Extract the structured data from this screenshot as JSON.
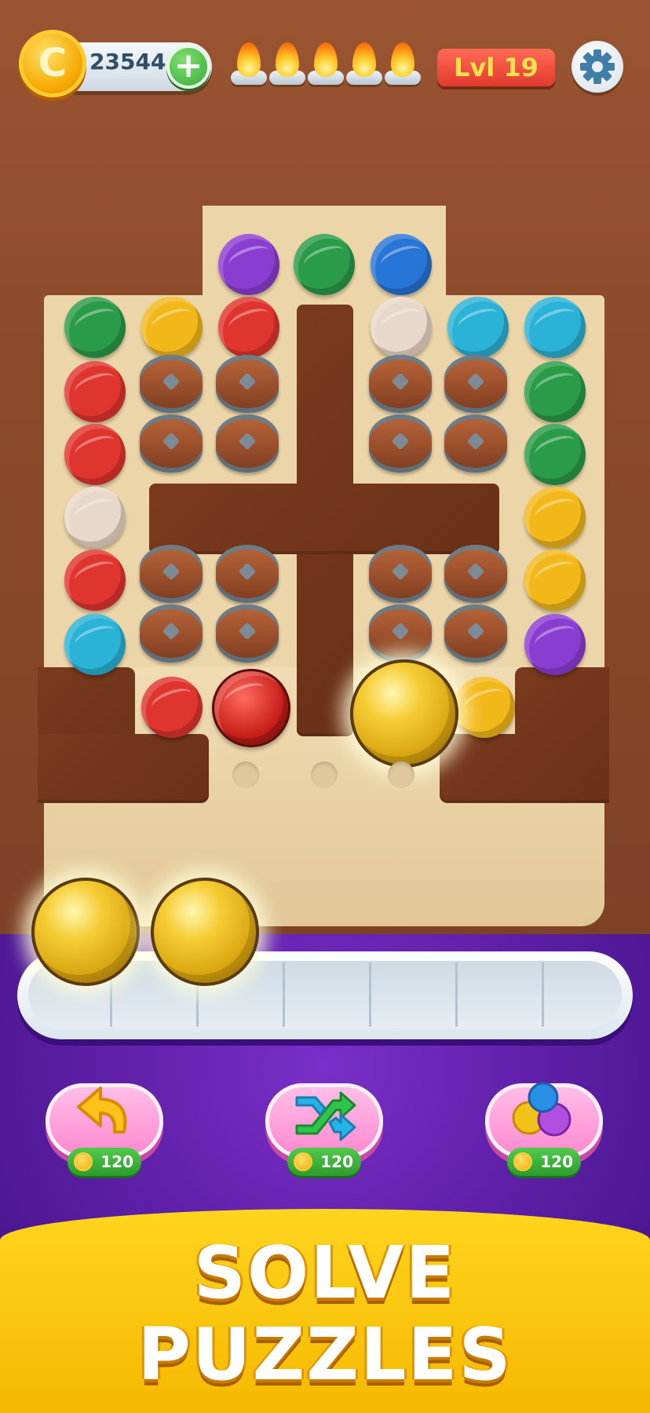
{
  "hud": {
    "coins": "23544",
    "coin_symbol": "C",
    "add_symbol": "+",
    "lives_count": 5,
    "level": "Lvl 19"
  },
  "colors": {
    "green": "#2a9b48",
    "yellow": "#f2b81a",
    "red": "#e0342e",
    "purple": "#8a3ed1",
    "blue": "#2775d6",
    "cyan": "#2ab3d6",
    "beige": "#e8d8c9",
    "brand_purple": "#5d1fa6",
    "banner_yellow": "#ffd51e"
  },
  "board": {
    "barrel_count": 16,
    "slot_count": 7,
    "queue_balls": [
      "yellow",
      "yellow"
    ]
  },
  "boosters": [
    {
      "name": "undo",
      "price": "120"
    },
    {
      "name": "shuffle",
      "price": "120"
    },
    {
      "name": "magnet",
      "price": "120"
    }
  ],
  "banner": {
    "line1": "SOLVE",
    "line2": "PUZZLES"
  }
}
